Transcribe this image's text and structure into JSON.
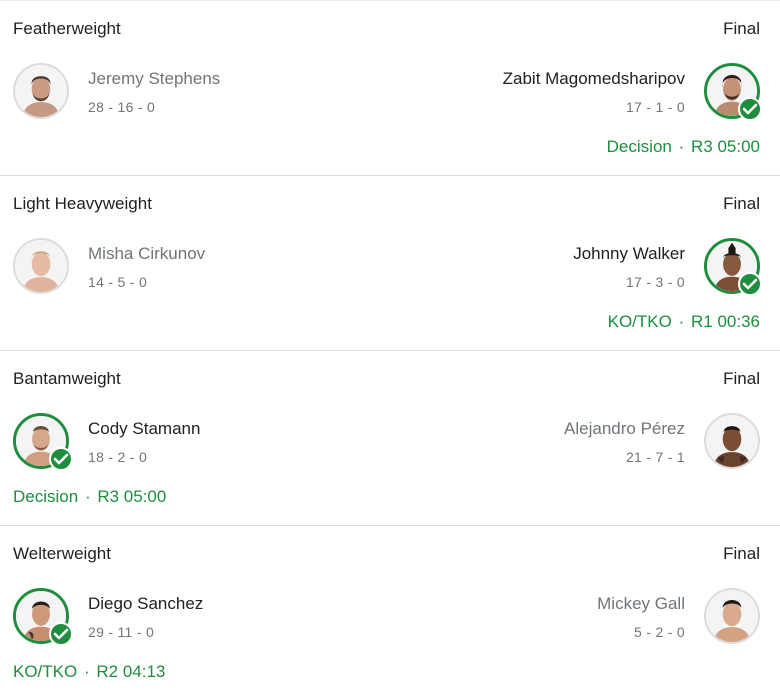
{
  "fights": [
    {
      "weight_class": "Featherweight",
      "status": "Final",
      "left": {
        "name": "Jeremy Stephens",
        "record": "28 - 16 - 0",
        "winner": false
      },
      "right": {
        "name": "Zabit Magomedsharipov",
        "record": "17 - 1 - 0",
        "winner": true
      },
      "result": {
        "method": "Decision",
        "separator": "·",
        "time": "R3 05:00",
        "side": "right"
      }
    },
    {
      "weight_class": "Light Heavyweight",
      "status": "Final",
      "left": {
        "name": "Misha Cirkunov",
        "record": "14 - 5 - 0",
        "winner": false
      },
      "right": {
        "name": "Johnny Walker",
        "record": "17 - 3 - 0",
        "winner": true
      },
      "result": {
        "method": "KO/TKO",
        "separator": "·",
        "time": "R1 00:36",
        "side": "right"
      }
    },
    {
      "weight_class": "Bantamweight",
      "status": "Final",
      "left": {
        "name": "Cody Stamann",
        "record": "18 - 2 - 0",
        "winner": true
      },
      "right": {
        "name": "Alejandro Pérez",
        "record": "21 - 7 - 1",
        "winner": false
      },
      "result": {
        "method": "Decision",
        "separator": "·",
        "time": "R3 05:00",
        "side": "left"
      }
    },
    {
      "weight_class": "Welterweight",
      "status": "Final",
      "left": {
        "name": "Diego Sanchez",
        "record": "29 - 11 - 0",
        "winner": true
      },
      "right": {
        "name": "Mickey Gall",
        "record": "5 - 2 - 0",
        "winner": false
      },
      "result": {
        "method": "KO/TKO",
        "separator": "·",
        "time": "R2 04:13",
        "side": "left"
      }
    }
  ],
  "colors": {
    "winner_green": "#1e8e3e",
    "muted_text": "#70757a",
    "primary_text": "#202124",
    "divider": "#dadce0"
  },
  "icons": {
    "avatar": "fighter-headshot-icon",
    "winner_badge": "checkmark-icon"
  }
}
